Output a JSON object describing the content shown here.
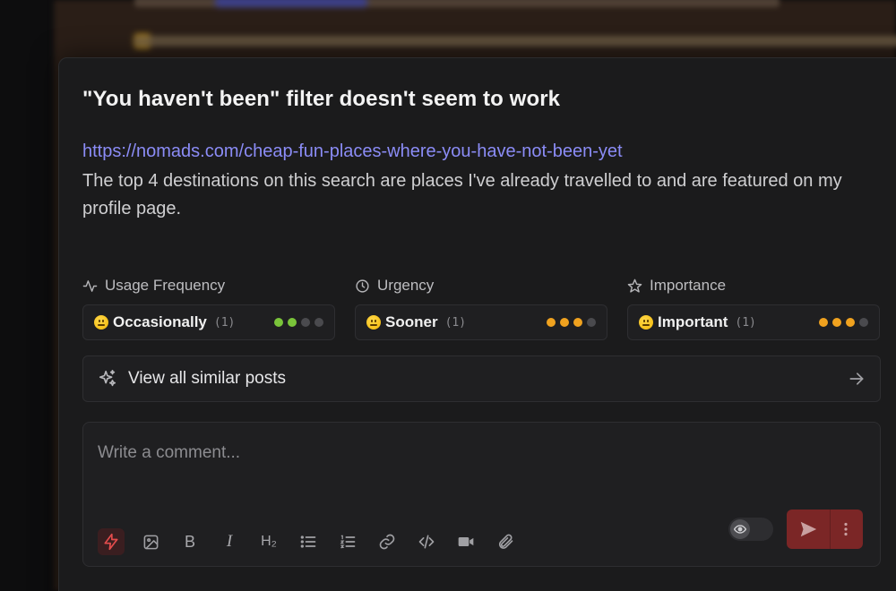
{
  "post": {
    "title": "\"You haven't been\" filter doesn't seem to work",
    "link": "https://nomads.com/cheap-fun-places-where-you-have-not-been-yet",
    "body": "The top 4 destinations on this search are places I've already travelled to and are featured on my profile page."
  },
  "meta": [
    {
      "label": "Usage Frequency",
      "icon": "activity-icon",
      "value": "Occasionally",
      "count": "(1)",
      "level": 2,
      "color": "#7ac43a"
    },
    {
      "label": "Urgency",
      "icon": "clock-icon",
      "value": "Sooner",
      "count": "(1)",
      "level": 3,
      "color": "#f0a21f"
    },
    {
      "label": "Importance",
      "icon": "star-icon",
      "value": "Important",
      "count": "(1)",
      "level": 3,
      "color": "#f0a21f"
    }
  ],
  "similar": {
    "label": "View all similar posts",
    "icon": "sparkles-icon"
  },
  "composer": {
    "placeholder": "Write a comment...",
    "tools": [
      "bolt-icon",
      "image-icon",
      "bold-icon",
      "italic-icon",
      "heading-icon",
      "bullet-list-icon",
      "numbered-list-icon",
      "link-icon",
      "code-icon",
      "video-icon",
      "attachment-icon"
    ],
    "bold_glyph": "B",
    "italic_glyph": "I",
    "heading_glyph": "H₂"
  },
  "colors": {
    "accent": "#8b8cf6",
    "send": "#7b2626",
    "danger": "#e34c4c"
  }
}
